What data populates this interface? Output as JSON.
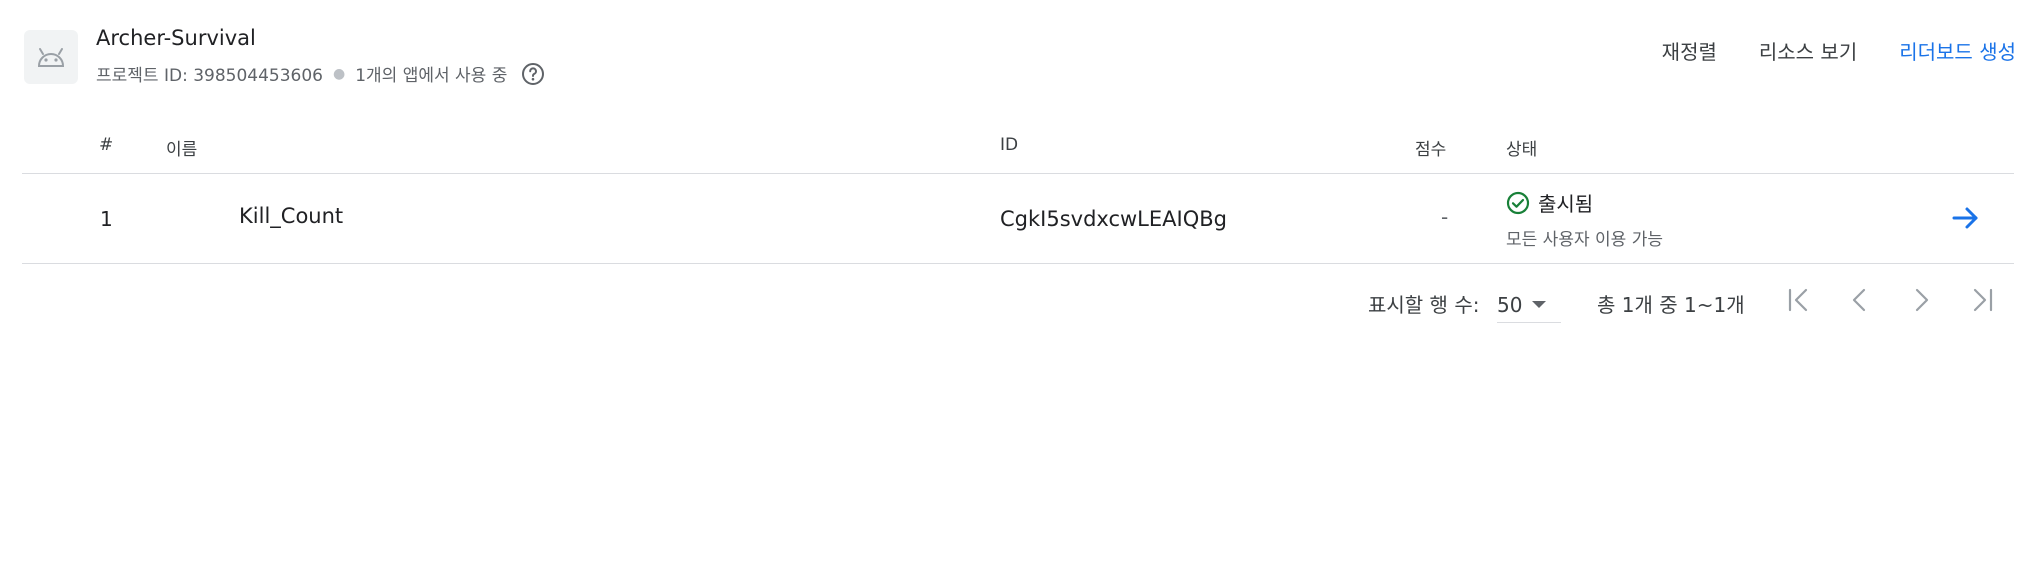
{
  "app": {
    "name": "Archer-Survival",
    "project_id_text": "프로젝트 ID: 398504453606",
    "usage_text": "1개의 앱에서 사용 중",
    "icon": "android-icon"
  },
  "actions": {
    "reorder": "재정렬",
    "view_resources": "리소스 보기",
    "create_leaderboard": "리더보드 생성"
  },
  "table": {
    "headers": {
      "num": "#",
      "name": "이름",
      "id": "ID",
      "score": "점수",
      "status": "상태"
    },
    "rows": [
      {
        "num": "1",
        "name": "Kill_Count",
        "id": "CgkI5svdxcwLEAIQBg",
        "score": "-",
        "status": "출시됨",
        "status_sub": "모든 사용자 이용 가능"
      }
    ]
  },
  "pagination": {
    "rows_per_page_label": "표시할 행 수:",
    "rows_per_page_value": "50",
    "range_text": "총 1개 중 1~1개"
  },
  "colors": {
    "accent": "#1a73e8",
    "status_ok": "#188038",
    "icon_bg": "#f1f3f4"
  }
}
